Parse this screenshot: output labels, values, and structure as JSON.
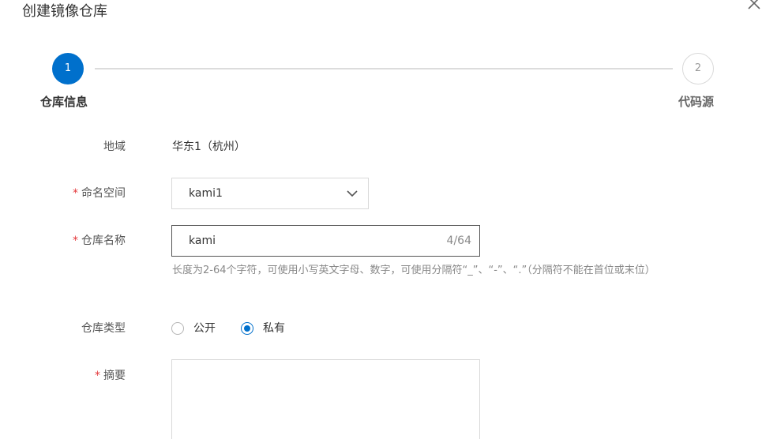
{
  "dialog": {
    "title": "创建镜像仓库",
    "close_icon": "close-icon"
  },
  "steps": [
    {
      "number": "1",
      "title": "仓库信息",
      "status": "active"
    },
    {
      "number": "2",
      "title": "代码源",
      "status": "pending"
    }
  ],
  "form": {
    "region": {
      "label": "地域",
      "value": "华东1（杭州）"
    },
    "namespace": {
      "required_mark": "*",
      "label": "命名空间",
      "value": "kami1",
      "icon": "chevron-down-icon"
    },
    "repo_name": {
      "required_mark": "*",
      "label": "仓库名称",
      "value": "kami",
      "counter": "4/64",
      "helper": "长度为2-64个字符，可使用小写英文字母、数字，可使用分隔符“_”、“-”、“.”（分隔符不能在首位或末位）"
    },
    "repo_type": {
      "label": "仓库类型",
      "options": [
        {
          "label": "公开",
          "checked": false
        },
        {
          "label": "私有",
          "checked": true
        }
      ]
    },
    "summary": {
      "required_mark": "*",
      "label": "摘要",
      "value": ""
    }
  },
  "colors": {
    "accent": "#0070cc",
    "required": "#e4393c",
    "border": "#d9d9d9",
    "helper_text": "#888888"
  }
}
